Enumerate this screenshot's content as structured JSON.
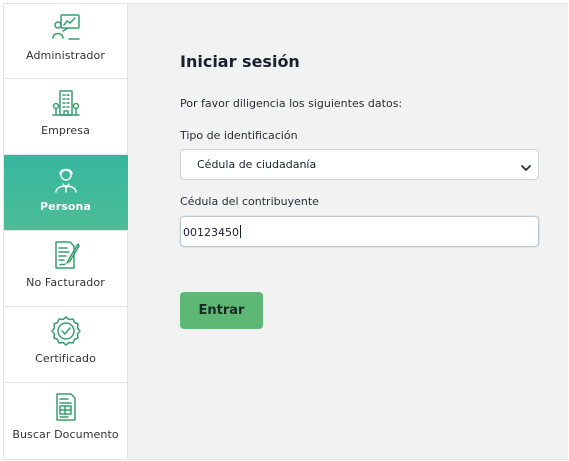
{
  "sidebar": {
    "items": [
      {
        "label": "Administrador",
        "icon": "admin-board-icon"
      },
      {
        "label": "Empresa",
        "icon": "building-icon"
      },
      {
        "label": "Persona",
        "icon": "person-icon",
        "active": true
      },
      {
        "label": "No Facturador",
        "icon": "document-pen-icon"
      },
      {
        "label": "Certificado",
        "icon": "certificate-seal-icon"
      },
      {
        "label": "Buscar Documento",
        "icon": "search-document-icon"
      }
    ]
  },
  "form": {
    "title": "Iniciar sesión",
    "intro": "Por favor diligencia los siguientes datos:",
    "id_type_label": "Tipo de identificación",
    "id_type_value": "Cédula de ciudadanía",
    "cedula_label": "Cédula del contribuyente",
    "cedula_value": "00123450",
    "submit_label": "Entrar"
  },
  "colors": {
    "accent": "#3fb89c",
    "icon_green": "#3a9d6e",
    "button": "#5cb874",
    "panel_bg": "#f2f2f3"
  }
}
